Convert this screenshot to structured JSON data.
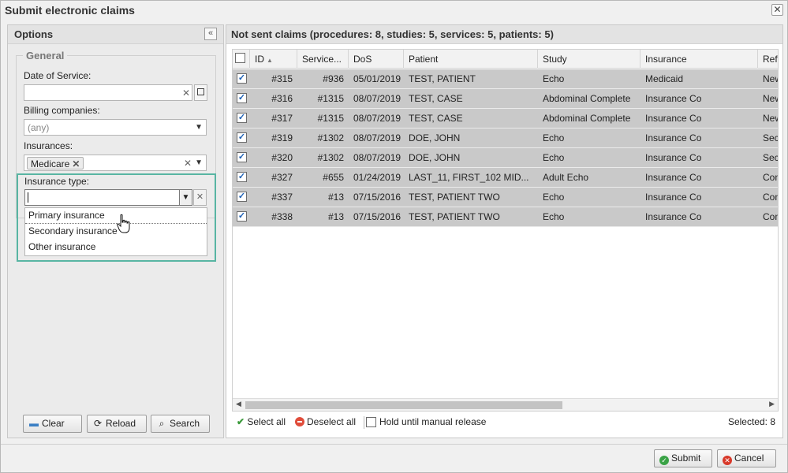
{
  "dialog": {
    "title": "Submit electronic claims",
    "close_glyph": "✕"
  },
  "options": {
    "title": "Options",
    "collapse_glyph": "«",
    "general_legend": "General",
    "date_of_service": {
      "label": "Date of Service:",
      "value": "",
      "clear_glyph": "✕"
    },
    "billing_companies": {
      "label": "Billing companies:",
      "placeholder": "(any)"
    },
    "insurances": {
      "label": "Insurances:",
      "tag": "Medicare",
      "tag_remove": "✕",
      "clear_glyph": "✕"
    },
    "insurance_type": {
      "label": "Insurance type:",
      "value": "",
      "clear_glyph": "✕",
      "options": [
        "Primary insurance",
        "Secondary insurance",
        "Other insurance"
      ]
    },
    "buttons": {
      "clear": "Clear",
      "reload": "Reload",
      "search": "Search"
    }
  },
  "claims": {
    "title": "Not sent claims (procedures: 8, studies: 5, services: 5, patients: 5)",
    "columns": [
      "ID",
      "Service...",
      "DoS",
      "Patient",
      "Study",
      "Insurance",
      "Ref"
    ],
    "rows": [
      {
        "id": "#315",
        "service": "#936",
        "dos": "05/01/2019",
        "patient": "TEST, PATIENT",
        "study": "Echo",
        "insurance": "Medicaid",
        "ref": "New"
      },
      {
        "id": "#316",
        "service": "#1315",
        "dos": "08/07/2019",
        "patient": "TEST, CASE",
        "study": "Abdominal Complete",
        "insurance": "Insurance Co",
        "ref": "New"
      },
      {
        "id": "#317",
        "service": "#1315",
        "dos": "08/07/2019",
        "patient": "TEST, CASE",
        "study": "Abdominal Complete",
        "insurance": "Insurance Co",
        "ref": "New"
      },
      {
        "id": "#319",
        "service": "#1302",
        "dos": "08/07/2019",
        "patient": "DOE, JOHN",
        "study": "Echo",
        "insurance": "Insurance Co",
        "ref": "Sec"
      },
      {
        "id": "#320",
        "service": "#1302",
        "dos": "08/07/2019",
        "patient": "DOE, JOHN",
        "study": "Echo",
        "insurance": "Insurance Co",
        "ref": "Sec"
      },
      {
        "id": "#327",
        "service": "#655",
        "dos": "01/24/2019",
        "patient": "LAST_11, FIRST_102 MID...",
        "study": "Adult Echo",
        "insurance": "Insurance Co",
        "ref": "Con"
      },
      {
        "id": "#337",
        "service": "#13",
        "dos": "07/15/2016",
        "patient": "TEST, PATIENT TWO",
        "study": "Echo",
        "insurance": "Insurance Co",
        "ref": "Con"
      },
      {
        "id": "#338",
        "service": "#13",
        "dos": "07/15/2016",
        "patient": "TEST, PATIENT TWO",
        "study": "Echo",
        "insurance": "Insurance Co",
        "ref": "Con"
      }
    ],
    "footer": {
      "select_all": "Select all",
      "deselect_all": "Deselect all",
      "hold": "Hold until manual release",
      "selected": "Selected: 8"
    }
  },
  "bottom": {
    "submit": "Submit",
    "cancel": "Cancel"
  }
}
